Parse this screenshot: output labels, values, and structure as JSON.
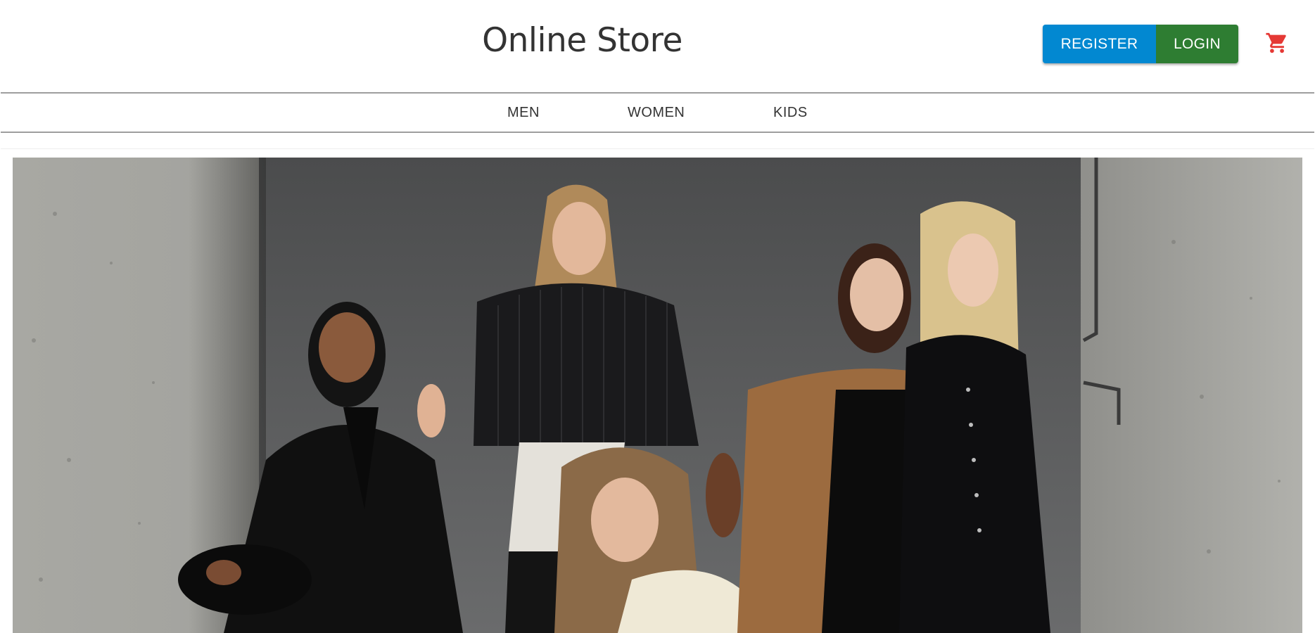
{
  "header": {
    "title": "Online Store",
    "register_label": "REGISTER",
    "login_label": "LOGIN",
    "cart_icon": "shopping-cart-icon",
    "colors": {
      "register": "#0288d1",
      "login": "#2e7d32",
      "cart": "#e53935"
    }
  },
  "nav": {
    "items": [
      {
        "label": "MEN"
      },
      {
        "label": "WOMEN"
      },
      {
        "label": "KIDS"
      }
    ]
  },
  "hero": {
    "image": "fashion-models-photo"
  }
}
